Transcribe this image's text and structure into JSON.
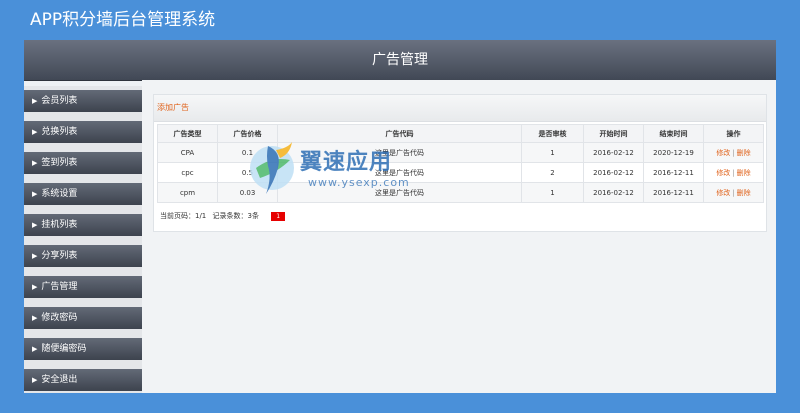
{
  "app": {
    "title": "APP积分墙后台管理系统"
  },
  "header": {
    "title": "广告管理"
  },
  "sidebar": {
    "items": [
      {
        "label": "会员列表"
      },
      {
        "label": "兑换列表"
      },
      {
        "label": "签到列表"
      },
      {
        "label": "系统设置"
      },
      {
        "label": "挂机列表"
      },
      {
        "label": "分享列表"
      },
      {
        "label": "广告管理"
      },
      {
        "label": "修改密码"
      },
      {
        "label": "随便编密码"
      },
      {
        "label": "安全退出"
      }
    ]
  },
  "main": {
    "add_label": "添加广告",
    "table": {
      "headers": [
        "广告类型",
        "广告价格",
        "广告代码",
        "是否审核",
        "开始时间",
        "结束时间",
        "操作"
      ],
      "rows": [
        {
          "type": "CPA",
          "price": "0.1",
          "code": "这里是广告代码",
          "audit": "1",
          "start": "2016-02-12",
          "end": "2020-12-19"
        },
        {
          "type": "cpc",
          "price": "0.5",
          "code": "这里是广告代码",
          "audit": "2",
          "start": "2016-02-12",
          "end": "2016-12-11"
        },
        {
          "type": "cpm",
          "price": "0.03",
          "code": "这里是广告代码",
          "audit": "1",
          "start": "2016-02-12",
          "end": "2016-12-11"
        }
      ],
      "edit_label": "修改",
      "separator": "|",
      "delete_label": "删除"
    },
    "pager": {
      "current_page": "当前页码：1/1",
      "record_count": "记录条数：3条",
      "page": "1"
    }
  },
  "watermark": {
    "text": "翼速应用",
    "url": "www.ysexp.com"
  },
  "colors": {
    "accent": "#e0631c",
    "background": "#4a90d9",
    "header": "#4e5562",
    "pager_active": "#e60000"
  }
}
